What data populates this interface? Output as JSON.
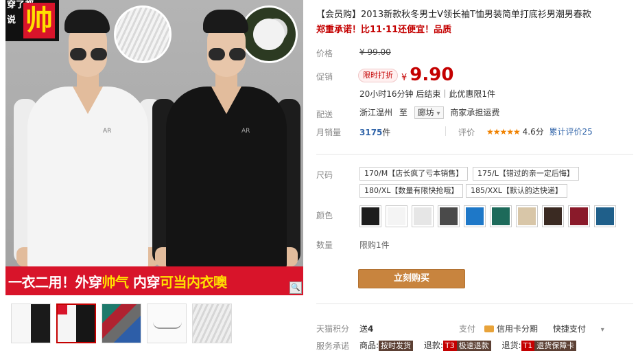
{
  "gallery": {
    "badge": {
      "line1": "穿了都",
      "line2": "说",
      "big": "帅"
    },
    "banner": {
      "part1": "一衣二用！外穿",
      "part2": "帅气",
      "part3": " 内穿",
      "part4": "可当内衣噢"
    },
    "brand_mark": "AR",
    "zoom_icon": "🔍",
    "thumbnails": [
      "thumb-1",
      "thumb-2",
      "thumb-3",
      "thumb-4",
      "thumb-5"
    ],
    "active_thumbnail": 1
  },
  "product": {
    "title": "【会员购】2013新款秋冬男士V领长袖T恤男装简单打底衫男潮男春款",
    "subtitle": "郑重承诺！比11·11还便宜！品质"
  },
  "price": {
    "label": "价格",
    "original": "¥ 99.00",
    "promo_label": "促销",
    "promo_tag": "限时打折",
    "currency": "¥",
    "current": "9.90",
    "countdown": "20小时16分钟 后结束｜此优惠限1件"
  },
  "shipping": {
    "label": "配送",
    "from": "浙江温州",
    "to_word": "至",
    "to": "廊坊",
    "to_caret": "▾",
    "fee": "商家承担运费"
  },
  "sales": {
    "label": "月销量",
    "count": "3175",
    "unit": "件",
    "rating_label": "评价",
    "stars": "★★★★★",
    "score": "4.6分",
    "review_text": "累计评价25"
  },
  "size": {
    "label": "尺码",
    "options": [
      "170/M【店长疯了亏本销售】",
      "175/L【错过的亲一定后悔】",
      "180/XL【数量有限快抢哦】",
      "185/XXL【默认韵达快递】"
    ]
  },
  "color": {
    "label": "颜色",
    "swatches": [
      "#1d1d1d",
      "#f4f4f4",
      "#e6e6e6",
      "#4a4a4a",
      "#1e78c8",
      "#1d6a5a",
      "#d8c6a8",
      "#3a2a22",
      "#8a1a2a",
      "#1f5f8a"
    ]
  },
  "quantity": {
    "label": "数量",
    "limit": "限购1件"
  },
  "buy_button": "立刻购买",
  "footer": {
    "points_label": "天猫积分",
    "points_prefix": "送",
    "points_value": "4",
    "pay_label": "支付",
    "credit_pay": "信用卡分期",
    "quick_pay": "快捷支付",
    "pay_caret": "▾",
    "service_label": "服务承诺",
    "service_goods": "商品:",
    "service_goods_tag": "按时发货",
    "service_refund": "退款:",
    "service_refund_code": "T3",
    "service_refund_tag": "极速退款",
    "service_return": "退货:",
    "service_return_code": "T1",
    "service_return_tag": "退货保障卡"
  }
}
